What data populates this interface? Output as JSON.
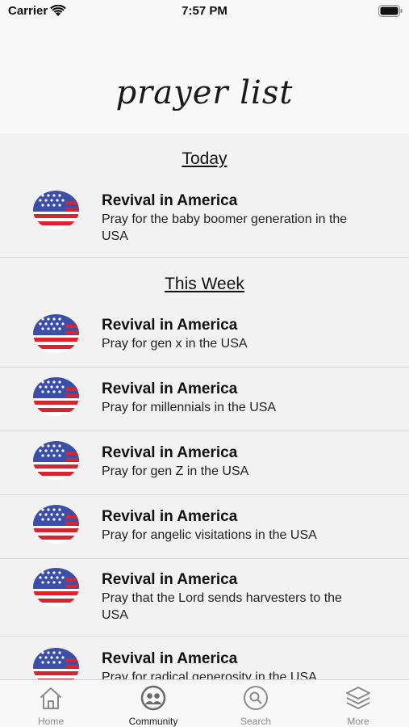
{
  "status_bar": {
    "carrier": "Carrier",
    "time": "7:57 PM"
  },
  "header": {
    "title": "prayer list"
  },
  "sections": [
    {
      "heading": "Today",
      "items": [
        {
          "title": "Revival in America",
          "subtitle": "Pray for the baby boomer generation in the  USA",
          "icon": "us-flag-icon"
        }
      ]
    },
    {
      "heading": "This Week",
      "items": [
        {
          "title": "Revival in America",
          "subtitle": "Pray for gen x in the USA",
          "icon": "us-flag-icon"
        },
        {
          "title": "Revival in America",
          "subtitle": "Pray for millennials in the USA",
          "icon": "us-flag-icon"
        },
        {
          "title": "Revival in America",
          "subtitle": "Pray for gen Z in the USA",
          "icon": "us-flag-icon"
        },
        {
          "title": "Revival in America",
          "subtitle": "Pray for angelic visitations in the USA",
          "icon": "us-flag-icon"
        },
        {
          "title": "Revival in America",
          "subtitle": "Pray that the Lord sends harvesters to the USA",
          "icon": "us-flag-icon"
        },
        {
          "title": "Revival in America",
          "subtitle": "Pray for radical generosity in the USA",
          "icon": "us-flag-icon"
        }
      ]
    }
  ],
  "tab_bar": {
    "tabs": [
      {
        "label": "Home",
        "icon": "home-icon",
        "active": false
      },
      {
        "label": "Community",
        "icon": "community-icon",
        "active": true
      },
      {
        "label": "Search",
        "icon": "search-icon",
        "active": false
      },
      {
        "label": "More",
        "icon": "layers-icon",
        "active": false
      }
    ]
  },
  "colors": {
    "flag_blue": "#3c4fa8",
    "flag_red": "#d7242e",
    "background": "#f2f2f2",
    "bar_background": "#f8f8f8"
  }
}
